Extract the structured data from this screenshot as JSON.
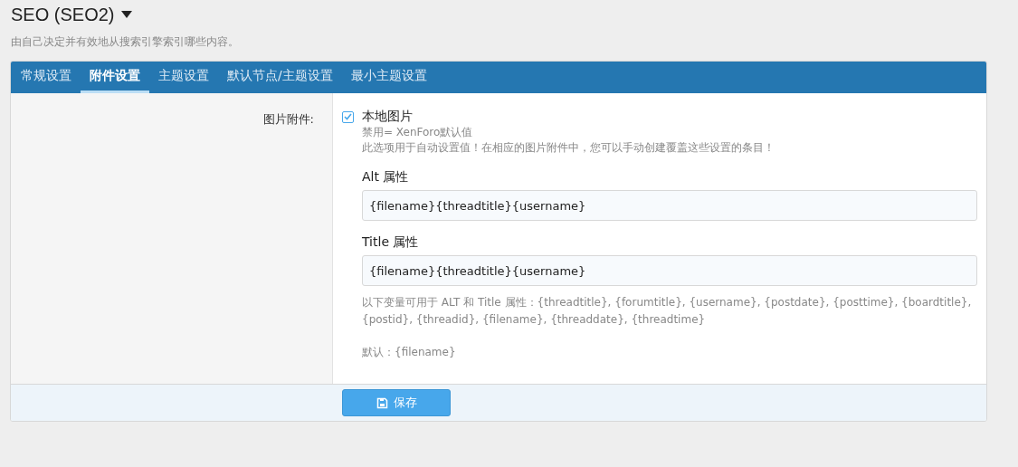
{
  "page": {
    "title": "SEO (SEO2)",
    "description": "由自己决定并有效地从搜索引擎索引哪些内容。"
  },
  "tabs": [
    {
      "label": "常规设置",
      "selected": false
    },
    {
      "label": "附件设置",
      "selected": true
    },
    {
      "label": "主题设置",
      "selected": false
    },
    {
      "label": "默认节点/主题设置",
      "selected": false
    },
    {
      "label": "最小主题设置",
      "selected": false
    }
  ],
  "option": {
    "label": "图片附件:",
    "checkbox": {
      "label": "本地图片",
      "checked": true
    },
    "hints": [
      "禁用= XenForo默认值",
      "此选项用于自动设置值！在相应的图片附件中，您可以手动创建覆盖这些设置的条目！"
    ],
    "fields": [
      {
        "label": "Alt 属性",
        "value": "{filename}{threadtitle}{username}"
      },
      {
        "label": "Title 属性",
        "value": "{filename}{threadtitle}{username}"
      }
    ],
    "explain": "以下变量可用于 ALT 和 Title 属性：{threadtitle}, {forumtitle}, {username}, {postdate}, {posttime}, {boardtitle}, {postid}, {threadid}, {filename}, {threaddate}, {threadtime}",
    "default": "默认：{filename}"
  },
  "save_button": "保存"
}
